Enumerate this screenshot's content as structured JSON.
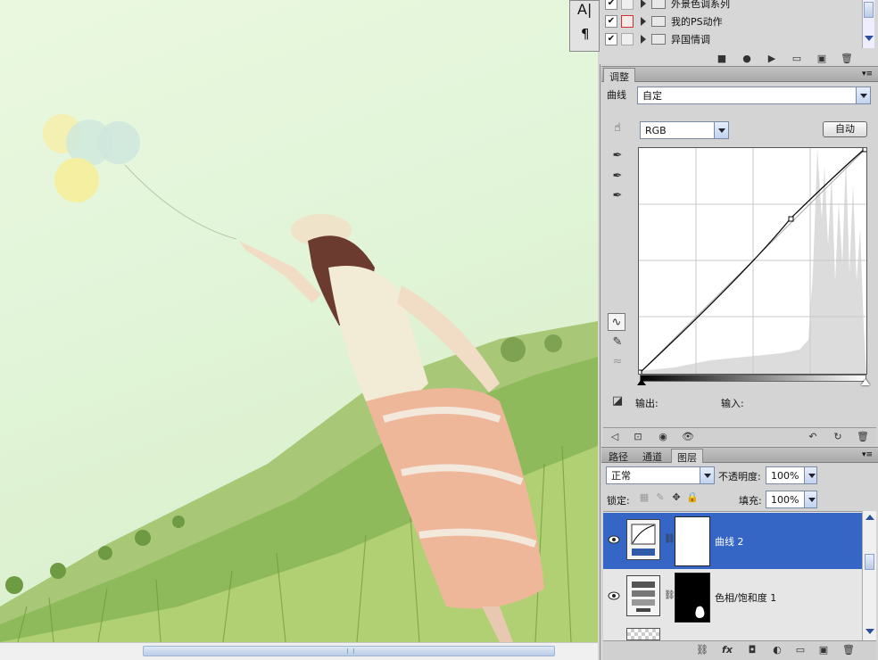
{
  "actions_panel": {
    "rows": [
      {
        "label": "外景色调系列",
        "checked": true
      },
      {
        "label": "我的PS动作",
        "checked": true
      },
      {
        "label": "异国情调",
        "checked": true
      }
    ]
  },
  "mini_tools": {
    "text_glyph": "A|",
    "para_glyph": "¶"
  },
  "adjust_panel": {
    "tab": "调整",
    "preset_label": "曲线",
    "preset_value": "自定",
    "channel_value": "RGB",
    "auto_button": "自动",
    "output_label": "输出:",
    "input_label": "输入:"
  },
  "layers_panel": {
    "tabs": [
      "路径",
      "通道",
      "图层"
    ],
    "active_tab": "图层",
    "blend_mode": "正常",
    "opacity_label": "不透明度:",
    "opacity_value": "100%",
    "lock_label": "锁定:",
    "fill_label": "填充:",
    "fill_value": "100%",
    "layers": [
      {
        "name": "曲线 2",
        "selected": true
      },
      {
        "name": "色相/饱和度 1",
        "selected": false
      }
    ]
  },
  "colors": {
    "selection": "#3566c5",
    "panel_bg": "#d4d4d4"
  }
}
